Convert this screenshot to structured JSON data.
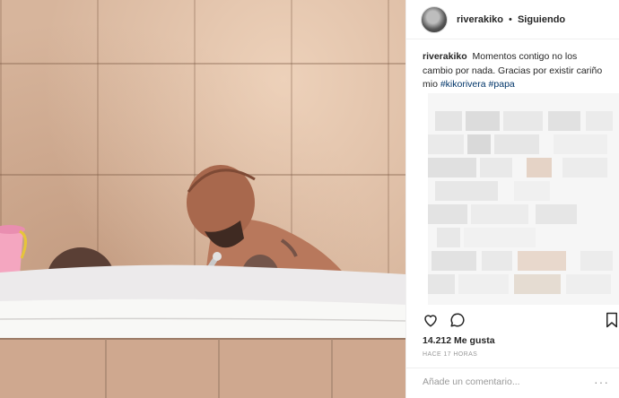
{
  "post": {
    "username": "riverakiko",
    "separator": "•",
    "follow_status": "Siguiendo",
    "caption": {
      "username": "riverakiko",
      "text": "Momentos contigo no los cambio por nada. Gracias por existir cariño mio",
      "hashtags": [
        "#kikorivera",
        "#papa"
      ]
    },
    "likes": "14.212 Me gusta",
    "time": "HACE 17 HORAS",
    "comment_placeholder": "Añade un comentario...",
    "more_label": "···"
  },
  "icons": {
    "like": "heart-icon",
    "comment": "comment-icon",
    "save": "bookmark-icon"
  },
  "colors": {
    "hashtag": "#003569",
    "muted": "#999999",
    "text": "#262626"
  }
}
